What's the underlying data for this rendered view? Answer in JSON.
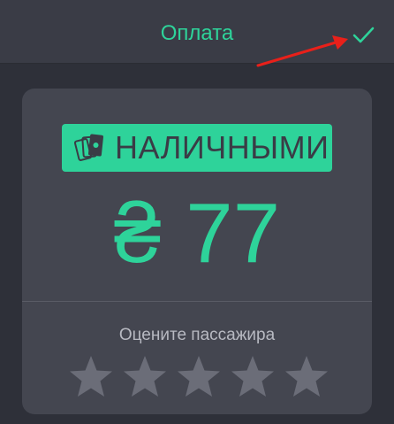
{
  "header": {
    "title": "Оплата",
    "confirm_icon": "checkmark-icon"
  },
  "payment": {
    "method_label": "НАЛИЧНЫМИ",
    "method_icon": "cash-icon",
    "currency_symbol": "₴",
    "amount": "77"
  },
  "rating": {
    "label": "Оцените пассажира",
    "max_stars": 5,
    "selected": 0
  },
  "colors": {
    "accent": "#2ed39a",
    "background": "#2e3039",
    "header": "#3a3c46",
    "card": "#444650",
    "star_inactive": "#6b6d78",
    "annotation_arrow": "#e8201a"
  }
}
